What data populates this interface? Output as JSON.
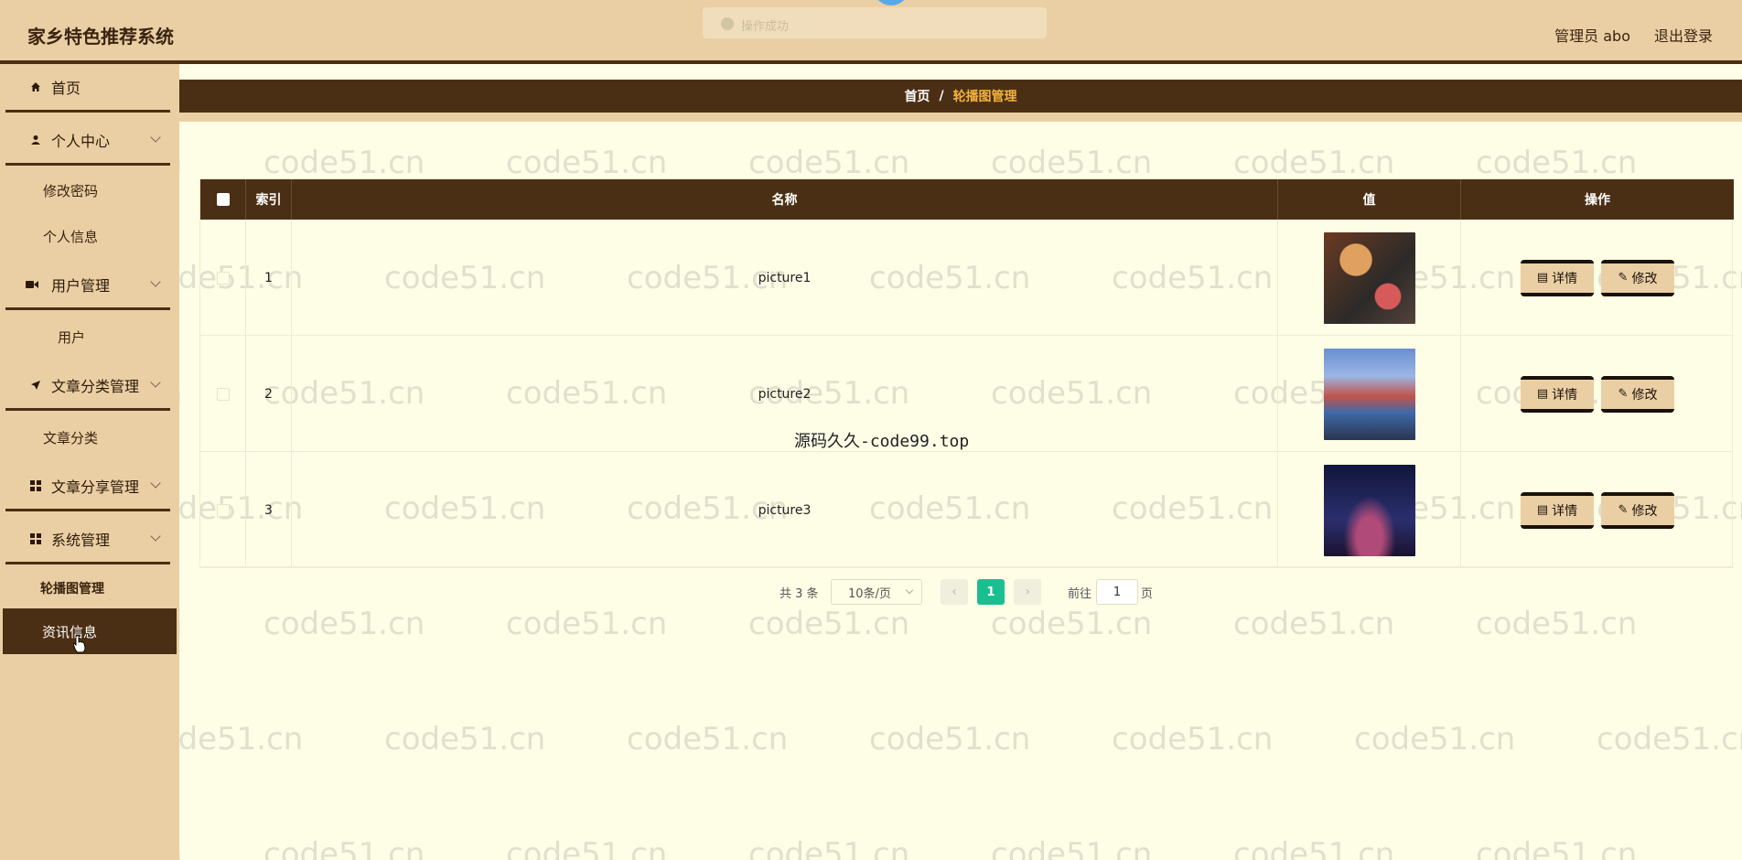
{
  "header": {
    "brand": "家乡特色推荐系统",
    "user_label": "管理员 abo",
    "logout_label": "退出登录",
    "toast_text": "操作成功"
  },
  "sidebar": {
    "items": [
      {
        "label": "首页",
        "icon": "home-icon"
      },
      {
        "label": "个人中心",
        "icon": "user-icon"
      },
      {
        "label": "修改密码"
      },
      {
        "label": "个人信息"
      },
      {
        "label": "用户管理",
        "icon": "video-icon"
      },
      {
        "label": "用户"
      },
      {
        "label": "文章分类管理",
        "icon": "send-icon"
      },
      {
        "label": "文章分类"
      },
      {
        "label": "文章分享管理",
        "icon": "grid-icon"
      },
      {
        "label": "系统管理",
        "icon": "grid-icon"
      },
      {
        "label": "轮播图管理"
      },
      {
        "label": "资讯信息"
      }
    ]
  },
  "breadcrumb": {
    "home": "首页",
    "separator": "/",
    "current": "轮播图管理"
  },
  "table": {
    "columns": [
      "索引",
      "名称",
      "值",
      "操作"
    ],
    "rows": [
      {
        "index": "1",
        "name": "picture1"
      },
      {
        "index": "2",
        "name": "picture2"
      },
      {
        "index": "3",
        "name": "picture3"
      }
    ],
    "detail_label": "详情",
    "edit_label": "修改"
  },
  "pagination": {
    "total": "共 3 条",
    "page_size": "10条/页",
    "current_page": "1",
    "goto_label": "前往",
    "goto_value": "1",
    "page_unit": "页"
  },
  "overlay_text": "源码久久-code99.top",
  "watermark": "code51.cn",
  "colors": {
    "header_bg": "#ebcfa4",
    "dark_brown": "#4a2f14",
    "content_bg": "#fefde6",
    "accent_gold": "#f3b23c",
    "page_active": "#1bbf8f"
  }
}
